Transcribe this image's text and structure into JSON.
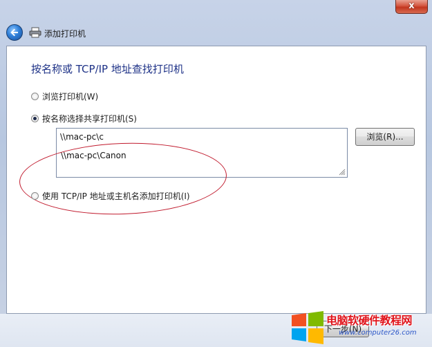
{
  "window": {
    "title": "添加打印机",
    "close_label": "x"
  },
  "content": {
    "heading": "按名称或 TCP/IP 地址查找打印机"
  },
  "options": [
    {
      "label": "浏览打印机(W)",
      "checked": false
    },
    {
      "label": "按名称选择共享打印机(S)",
      "checked": true
    },
    {
      "label": "使用 TCP/IP 地址或主机名添加打印机(I)",
      "checked": false
    }
  ],
  "printer_name": {
    "value": "\\\\mac-pc\\c",
    "suggestion": "\\\\mac-pc\\Canon"
  },
  "buttons": {
    "browse": "浏览(R)...",
    "next": "下一步(N)"
  },
  "watermark": {
    "title": "电脑软硬件教程网",
    "url": "www.computer26.com"
  },
  "colors": {
    "heading": "#1e3287",
    "annotation": "#c0192c"
  }
}
